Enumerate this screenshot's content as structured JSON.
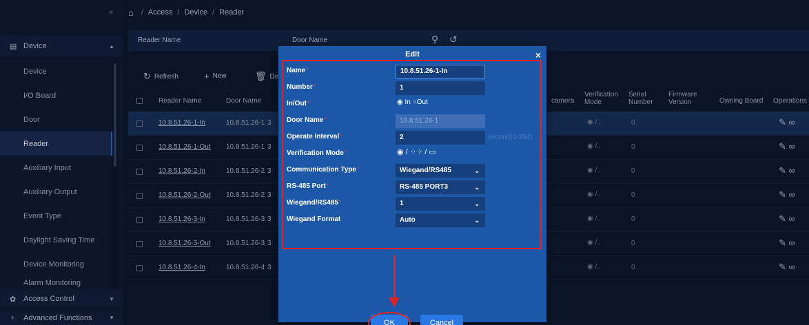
{
  "breadcrumb": {
    "items": [
      "Access",
      "Device",
      "Reader"
    ]
  },
  "filters": {
    "reader_name_label": "Reader Name",
    "door_name_label": "Door Name"
  },
  "toolbar": {
    "refresh": "Refresh",
    "new": "New",
    "delete": "Del"
  },
  "sidebar": {
    "device_group": "Device",
    "items": [
      "Device",
      "I/O Board",
      "Door",
      "Reader",
      "Auxiliary Input",
      "Auxiliary Output",
      "Event Type",
      "Daylight Saving Time",
      "Device Monitoring",
      "Alarm Monitoring"
    ],
    "active_item": "Reader",
    "access_control_group": "Access Control",
    "advanced_group": "Advanced Functions"
  },
  "table": {
    "headers": {
      "reader_name": "Reader Name",
      "door_name": "Door Name",
      "camera": "camera",
      "verification_mode": "Verification Mode",
      "serial_number": "Serial Number",
      "firmware_version": "Firmware Version",
      "owning_board": "Owning Board",
      "operations": "Operations"
    },
    "rows": [
      {
        "reader": "10.8.51.26-1-In",
        "door": "10.8.51.26-1",
        "num": "3",
        "serial": "0"
      },
      {
        "reader": "10.8.51.26-1-Out",
        "door": "10.8.51.26-1",
        "num": "3",
        "serial": "0"
      },
      {
        "reader": "10.8.51.26-2-In",
        "door": "10.8.51.26-2",
        "num": "3",
        "serial": "0"
      },
      {
        "reader": "10.8.51.26-2-Out",
        "door": "10.8.51.26-2",
        "num": "3",
        "serial": "0"
      },
      {
        "reader": "10.8.51.26-3-In",
        "door": "10.8.51.26-3",
        "num": "3",
        "serial": "0"
      },
      {
        "reader": "10.8.51.26-3-Out",
        "door": "10.8.51.26-3",
        "num": "3",
        "serial": "0"
      },
      {
        "reader": "10.8.51.26-4-In",
        "door": "10.8.51.26-4",
        "num": "3",
        "serial": "0"
      }
    ]
  },
  "modal": {
    "title": "Edit",
    "fields": {
      "name_label": "Name",
      "name_value": "10.8.51.26-1-In",
      "number_label": "Number",
      "number_value": "1",
      "inout_label": "In/Out",
      "in_option": "In",
      "out_option": "Out",
      "door_name_label": "Door Name",
      "door_name_value": "10.8.51.26-1",
      "interval_label": "Operate Interval",
      "interval_value": "2",
      "interval_hint": "second(0-254)",
      "verif_label": "Verification Mode",
      "comm_label": "Communication Type",
      "comm_value": "Wiegand/RS485",
      "rs485_label": "RS-485 Port",
      "rs485_value": "RS-485 PORT3",
      "wiegand_rs485_label": "Wiegand/RS485",
      "wiegand_rs485_value": "1",
      "wiegand_format_label": "Wiegand Format",
      "wiegand_format_value": "Auto"
    },
    "ok": "OK",
    "cancel": "Cancel"
  },
  "icons": [
    "home-icon",
    "search-icon",
    "reset-icon",
    "refresh-icon",
    "plus-icon",
    "trash-icon",
    "edit-icon",
    "link-icon",
    "close-icon",
    "fingerprint-icon",
    "card-icon",
    "keypad-icon",
    "gear-icon",
    "collapse-icon"
  ],
  "colors": {
    "accent": "#2a78e6",
    "modal": "#1d58a8",
    "highlight_red": "#e02424",
    "page_bg": "#0c1a33"
  }
}
